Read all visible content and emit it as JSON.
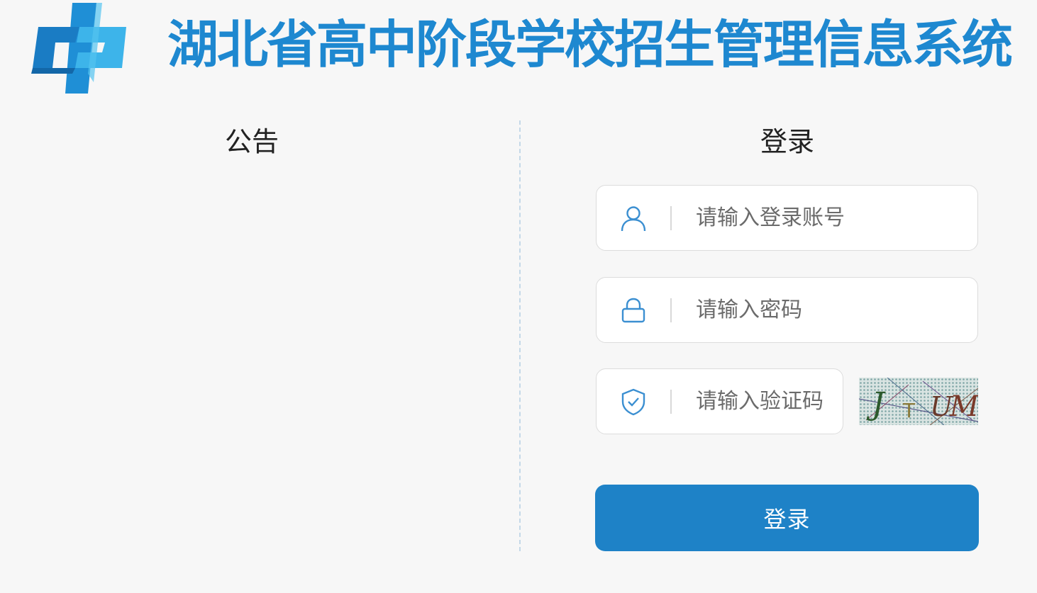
{
  "header": {
    "title": "湖北省高中阶段学校招生管理信息系统",
    "logo_icon": "zhong-character-logo-icon",
    "brand_color": "#1e88d0"
  },
  "notice": {
    "title": "公告"
  },
  "login": {
    "title": "登录",
    "account": {
      "placeholder": "请输入登录账号",
      "value": "",
      "icon": "user-icon"
    },
    "password": {
      "placeholder": "请输入密码",
      "value": "",
      "icon": "lock-icon"
    },
    "captcha": {
      "placeholder": "请输入验证码",
      "value": "",
      "icon": "shield-check-icon",
      "image_text": "JTUM"
    },
    "submit_label": "登录",
    "button_color": "#1e82c7",
    "icon_color": "#3b8fd1"
  }
}
